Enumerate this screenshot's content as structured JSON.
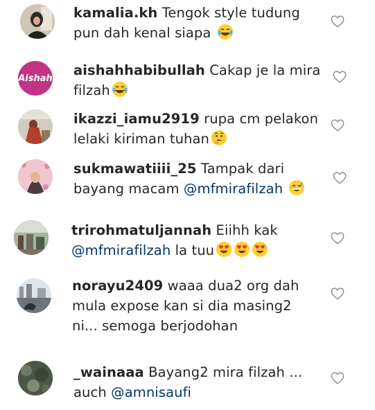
{
  "comments": [
    {
      "username": "kamalia.kh",
      "lines": [
        "Tengok style tudung",
        "pun dah kenal siapa "
      ],
      "emojis": [
        "😂"
      ]
    },
    {
      "username": "aishahhabibullah",
      "avatar_text": "Aishah",
      "lines": [
        "Cakap je la mira",
        "filzah"
      ],
      "emojis": [
        "😂"
      ]
    },
    {
      "username": "ikazzi_iamu2919",
      "lines": [
        "rupa cm pelakon",
        "lelaki kiriman tuhan"
      ],
      "emojis": [
        "🤔"
      ]
    },
    {
      "username": "sukmawatiiii_25",
      "lines": [
        "Tampak dari",
        "bayang macam "
      ],
      "mention": "@mfmirafilzah",
      "emojis": [
        "😅"
      ]
    },
    {
      "username": "trirohmatuljannah",
      "lines": [
        "Eiihh kak",
        " la tuu"
      ],
      "mention": "@mfmirafilzah",
      "emojis": [
        "😍",
        "😍",
        "😍"
      ]
    },
    {
      "username": "norayu2409",
      "lines": [
        "waaa dua2 org dah",
        "mula expose kan si dia masing2",
        "ni... semoga berjodohan"
      ]
    },
    {
      "username": "_wainaaa",
      "lines": [
        "Bayang2 mira filzah ...",
        "auch "
      ],
      "mention": "@amnisaufi"
    }
  ],
  "icons": {
    "like": "heart-outline-icon"
  },
  "colors": {
    "text": "#262626",
    "mention": "#003569",
    "heart": "#8e8e8e",
    "avatar_aishah": "#c13584"
  }
}
